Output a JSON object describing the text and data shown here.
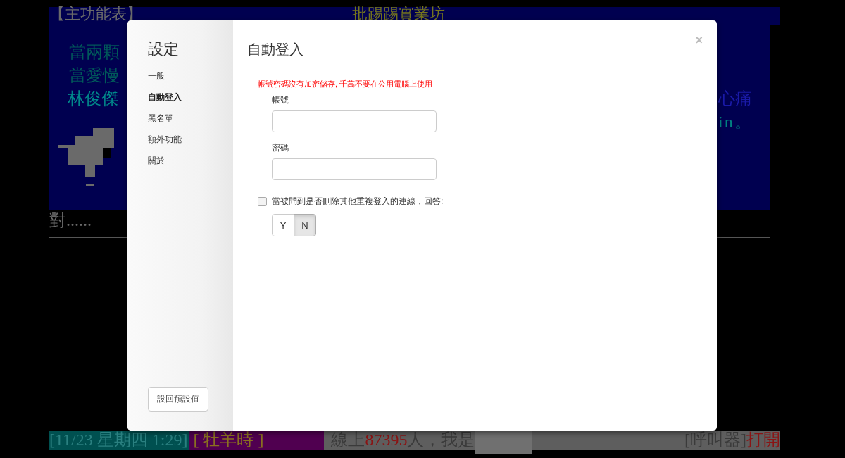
{
  "terminal": {
    "header_left": "【主功能表】",
    "header_right": "批踢踢實業坊",
    "lines": [
      {
        "left": "當兩顆",
        "kind": "dim"
      },
      {
        "left": "當愛慢",
        "kind": "dim"
      },
      {
        "left": "林俊傑",
        "right": "心痛",
        "kind": "bright"
      },
      {
        "right": "in。",
        "kind": "bright"
      }
    ],
    "below_line": "對......",
    "status_bar": {
      "clock": "[11/23 星期四 1:29]",
      "zodiac": "[ 牡羊時 ]",
      "online_prefix": "線上",
      "online_count": "87395",
      "online_suffix": "人，我是",
      "pager_label": "[呼叫器]",
      "pager_state": "打開"
    }
  },
  "dialog": {
    "sidebar_title": "設定",
    "nav": [
      {
        "label": "一般",
        "selected": false
      },
      {
        "label": "自動登入",
        "selected": true
      },
      {
        "label": "黑名單",
        "selected": false
      },
      {
        "label": "額外功能",
        "selected": false
      },
      {
        "label": "關於",
        "selected": false
      }
    ],
    "reset_button": "設回預設值",
    "title": "自動登入",
    "close": "×",
    "warning": "帳號密碼沒有加密儲存, 千萬不要在公用電腦上使用",
    "fields": [
      {
        "label": "帳號"
      },
      {
        "label": "密碼"
      }
    ],
    "checkbox": {
      "label": "當被問到是否刪除其他重複登入的連線，回答:",
      "checked": false
    },
    "answer_options": [
      {
        "label": "Y",
        "selected": false
      },
      {
        "label": "N",
        "selected": true
      }
    ]
  }
}
